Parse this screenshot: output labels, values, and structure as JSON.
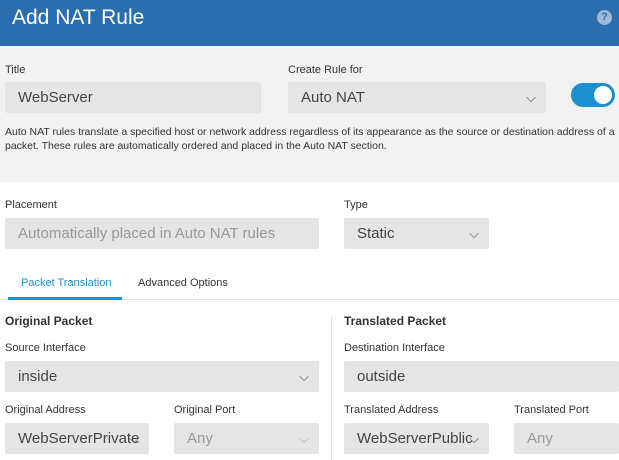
{
  "dialog": {
    "title": "Add NAT Rule",
    "help_glyph": "?"
  },
  "rule": {
    "title_label": "Title",
    "title_value": "WebServer",
    "create_label": "Create Rule for",
    "create_value": "Auto NAT",
    "enabled": true,
    "description": "Auto NAT rules translate a specified host or network address regardless of its appearance as the source or destination address of a packet. These rules are automatically ordered and placed in the Auto NAT section."
  },
  "placement": {
    "placement_label": "Placement",
    "placement_value": "Automatically placed in Auto NAT rules",
    "type_label": "Type",
    "type_value": "Static"
  },
  "tabs": [
    {
      "label": "Packet Translation",
      "active": true
    },
    {
      "label": "Advanced Options",
      "active": false
    }
  ],
  "original_packet": {
    "heading": "Original Packet",
    "source_interface_label": "Source Interface",
    "source_interface_value": "inside",
    "address_label": "Original Address",
    "address_value": "WebServerPrivate",
    "port_label": "Original Port",
    "port_value": "Any"
  },
  "translated_packet": {
    "heading": "Translated Packet",
    "dest_interface_label": "Destination Interface",
    "dest_interface_value": "outside",
    "address_label": "Translated Address",
    "address_value": "WebServerPublic",
    "port_label": "Translated Port",
    "port_value": "Any"
  },
  "icons": {
    "dropdown": "chevron-down-icon",
    "help": "help-icon"
  },
  "colors": {
    "header": "#2a6ead",
    "accent": "#1d8fcf",
    "field": "#e5e5e5",
    "panel": "#f2f2f2"
  }
}
